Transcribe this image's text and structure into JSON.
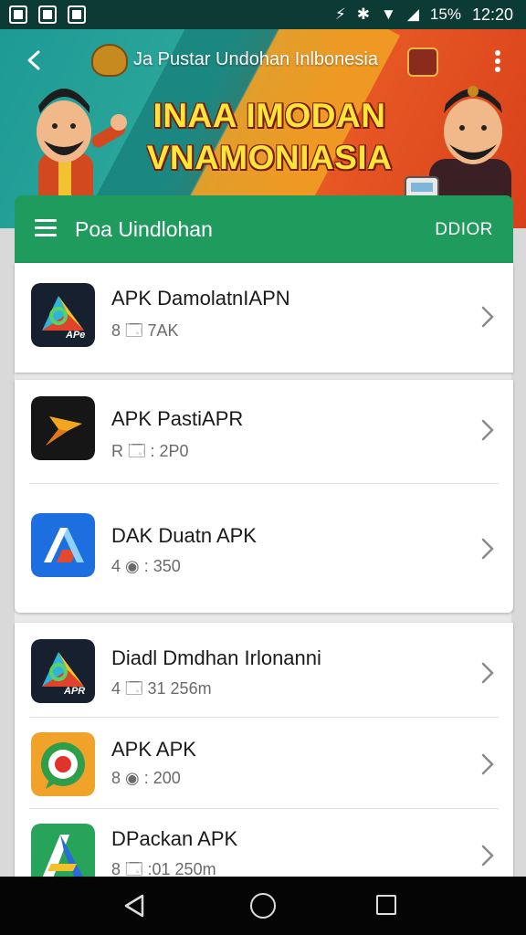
{
  "status_bar": {
    "battery": "15%",
    "time": "12:20"
  },
  "app_bar": {
    "title": "Ja Pustar Undohan Inlbonesia"
  },
  "banner": {
    "headline_line1": "INAA IMODAN",
    "headline_line2": "VNAMONIASIA"
  },
  "list_header": {
    "title": "Poa Uindlohan",
    "action": "DDIOR"
  },
  "apps": [
    {
      "name": "APK DamolatnIAPN",
      "meta": "8 🗔 7AK",
      "icon": "apk-logo-icon"
    },
    {
      "name": "APK PastiAPR",
      "meta": "R 🗔 : 2P0",
      "icon": "orange-arrow-icon"
    },
    {
      "name": "DAK Duatn APK",
      "meta": "4 ◉ : 350",
      "icon": "blue-a-icon"
    },
    {
      "name": "Diadl Dmdhan Irlonanni",
      "meta": "4 🗔 31 256m",
      "icon": "apr-logo-icon"
    },
    {
      "name": "APK APK",
      "meta": "8 ◉ : 200",
      "icon": "green-target-icon"
    },
    {
      "name": "DPackan APK",
      "meta": "8 🗔 :01 250m",
      "icon": "green-a-icon"
    }
  ],
  "colors": {
    "header_green": "#1f9b5e",
    "status_bar": "#0c3a34",
    "headline_yellow": "#ffe53a"
  }
}
